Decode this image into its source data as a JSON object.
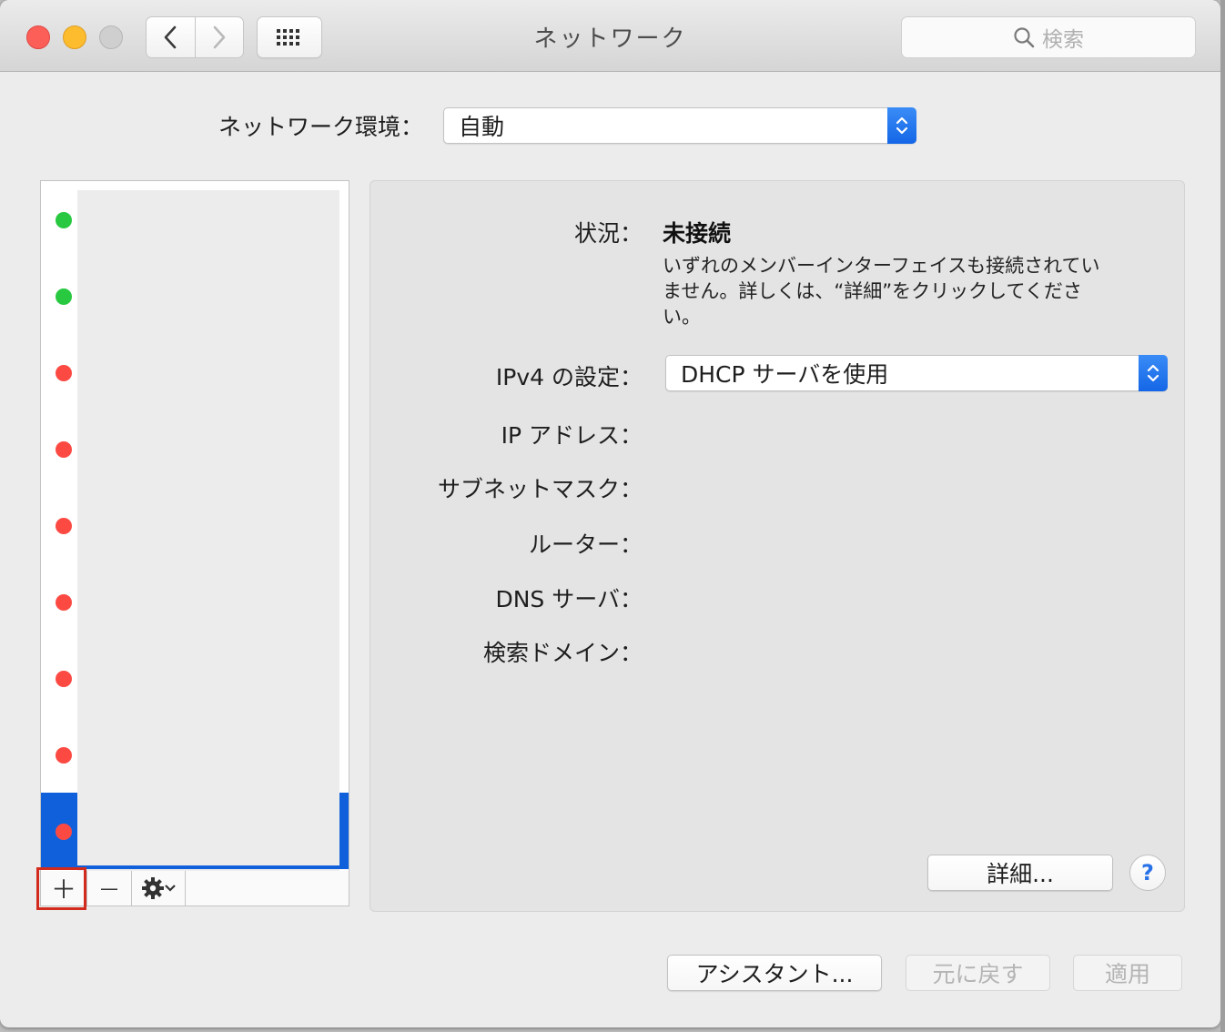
{
  "window": {
    "title": "ネットワーク"
  },
  "toolbar": {
    "back_glyph": "‹",
    "forward_glyph": "›",
    "search_placeholder": "検索",
    "icons": {
      "back": "chevron-left-icon",
      "forward": "chevron-right-icon",
      "show_all": "grid-icon",
      "search": "magnifier-icon"
    }
  },
  "location": {
    "label": "ネットワーク環境：",
    "value": "自動"
  },
  "services": {
    "items": [
      {
        "status": "green"
      },
      {
        "status": "green"
      },
      {
        "status": "red"
      },
      {
        "status": "red"
      },
      {
        "status": "red"
      },
      {
        "status": "red"
      },
      {
        "status": "red"
      },
      {
        "status": "red"
      },
      {
        "status": "red",
        "selected": true
      }
    ],
    "status_colors": {
      "green": "#28c940",
      "red": "#fc4a43"
    },
    "selection_color": "#1060dc",
    "add_label": "＋",
    "remove_label": "—",
    "action_icon": "gear-icon"
  },
  "detail": {
    "status_label": "状況：",
    "status_value": "未接続",
    "status_description": "いずれのメンバーインターフェイスも接続されていません。詳しくは、“詳細”をクリックしてください。",
    "ipv4_label": "IPv4 の設定：",
    "ipv4_value": "DHCP サーバを使用",
    "ip_label": "IP アドレス：",
    "subnet_label": "サブネットマスク：",
    "router_label": "ルーター：",
    "dns_label": "DNS サーバ：",
    "search_domain_label": "検索ドメイン：",
    "advanced_button": "詳細...",
    "help_glyph": "?"
  },
  "footer": {
    "assistant_button": "アシスタント...",
    "revert_button": "元に戻す",
    "apply_button": "適用"
  }
}
